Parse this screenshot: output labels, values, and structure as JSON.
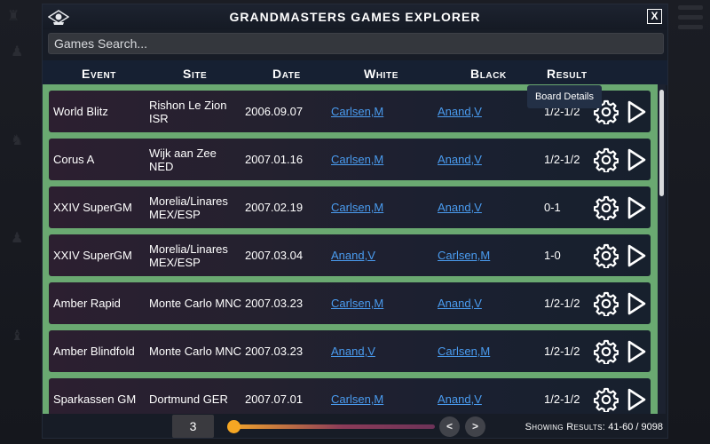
{
  "window": {
    "title": "Grandmasters Games Explorer",
    "close_label": "X"
  },
  "search": {
    "placeholder": "Games Search..."
  },
  "columns": {
    "event": "Event",
    "site": "Site",
    "date": "Date",
    "white": "White",
    "black": "Black",
    "result": "Result"
  },
  "games": [
    {
      "event": "World Blitz",
      "site_line1": "Rishon Le Zion",
      "site_line2": "ISR",
      "date": "2006.09.07",
      "white": "Carlsen,M",
      "black": "Anand,V",
      "result": "1/2-1/2"
    },
    {
      "event": "Corus A",
      "site_line1": "Wijk aan Zee",
      "site_line2": "NED",
      "date": "2007.01.16",
      "white": "Carlsen,M",
      "black": "Anand,V",
      "result": "1/2-1/2"
    },
    {
      "event": "XXIV SuperGM",
      "site_line1": "Morelia/Linares",
      "site_line2": "MEX/ESP",
      "date": "2007.02.19",
      "white": "Carlsen,M",
      "black": "Anand,V",
      "result": "0-1"
    },
    {
      "event": "XXIV SuperGM",
      "site_line1": "Morelia/Linares",
      "site_line2": "MEX/ESP",
      "date": "2007.03.04",
      "white": "Anand,V",
      "black": "Carlsen,M",
      "result": "1-0"
    },
    {
      "event": "Amber Rapid",
      "site_line1": "Monte Carlo MNC",
      "site_line2": "",
      "date": "2007.03.23",
      "white": "Carlsen,M",
      "black": "Anand,V",
      "result": "1/2-1/2"
    },
    {
      "event": "Amber Blindfold",
      "site_line1": "Monte Carlo MNC",
      "site_line2": "",
      "date": "2007.03.23",
      "white": "Anand,V",
      "black": "Carlsen,M",
      "result": "1/2-1/2"
    },
    {
      "event": "Sparkassen GM",
      "site_line1": "Dortmund GER",
      "site_line2": "",
      "date": "2007.07.01",
      "white": "Carlsen,M",
      "black": "Anand,V",
      "result": "1/2-1/2"
    }
  ],
  "tooltip": {
    "text": "Board Details"
  },
  "pagination": {
    "page": "3",
    "slider_fraction": 0.02,
    "prev_label": "<",
    "next_label": ">",
    "results_label": "Showing Results:",
    "results_value": "41-60 / 9098"
  },
  "colors": {
    "accent": "#f5a623",
    "link": "#4a9cf0",
    "row_frame": "#6aa971"
  },
  "icons": {
    "logo": "chess-eye-logo",
    "row_settings": "gear-icon",
    "row_play": "play-icon"
  }
}
